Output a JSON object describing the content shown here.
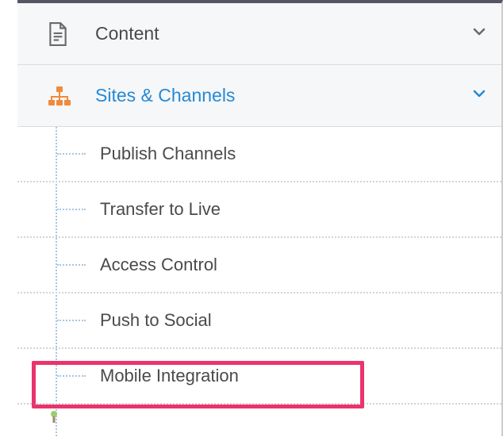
{
  "nav": {
    "content": {
      "label": "Content",
      "expanded": false
    },
    "sites_channels": {
      "label": "Sites & Channels",
      "expanded": true
    }
  },
  "subnav": {
    "items": [
      {
        "label": "Publish Channels"
      },
      {
        "label": "Transfer to Live"
      },
      {
        "label": "Access Control"
      },
      {
        "label": "Push to Social"
      },
      {
        "label": "Mobile Integration"
      }
    ]
  },
  "highlight_index": 4
}
